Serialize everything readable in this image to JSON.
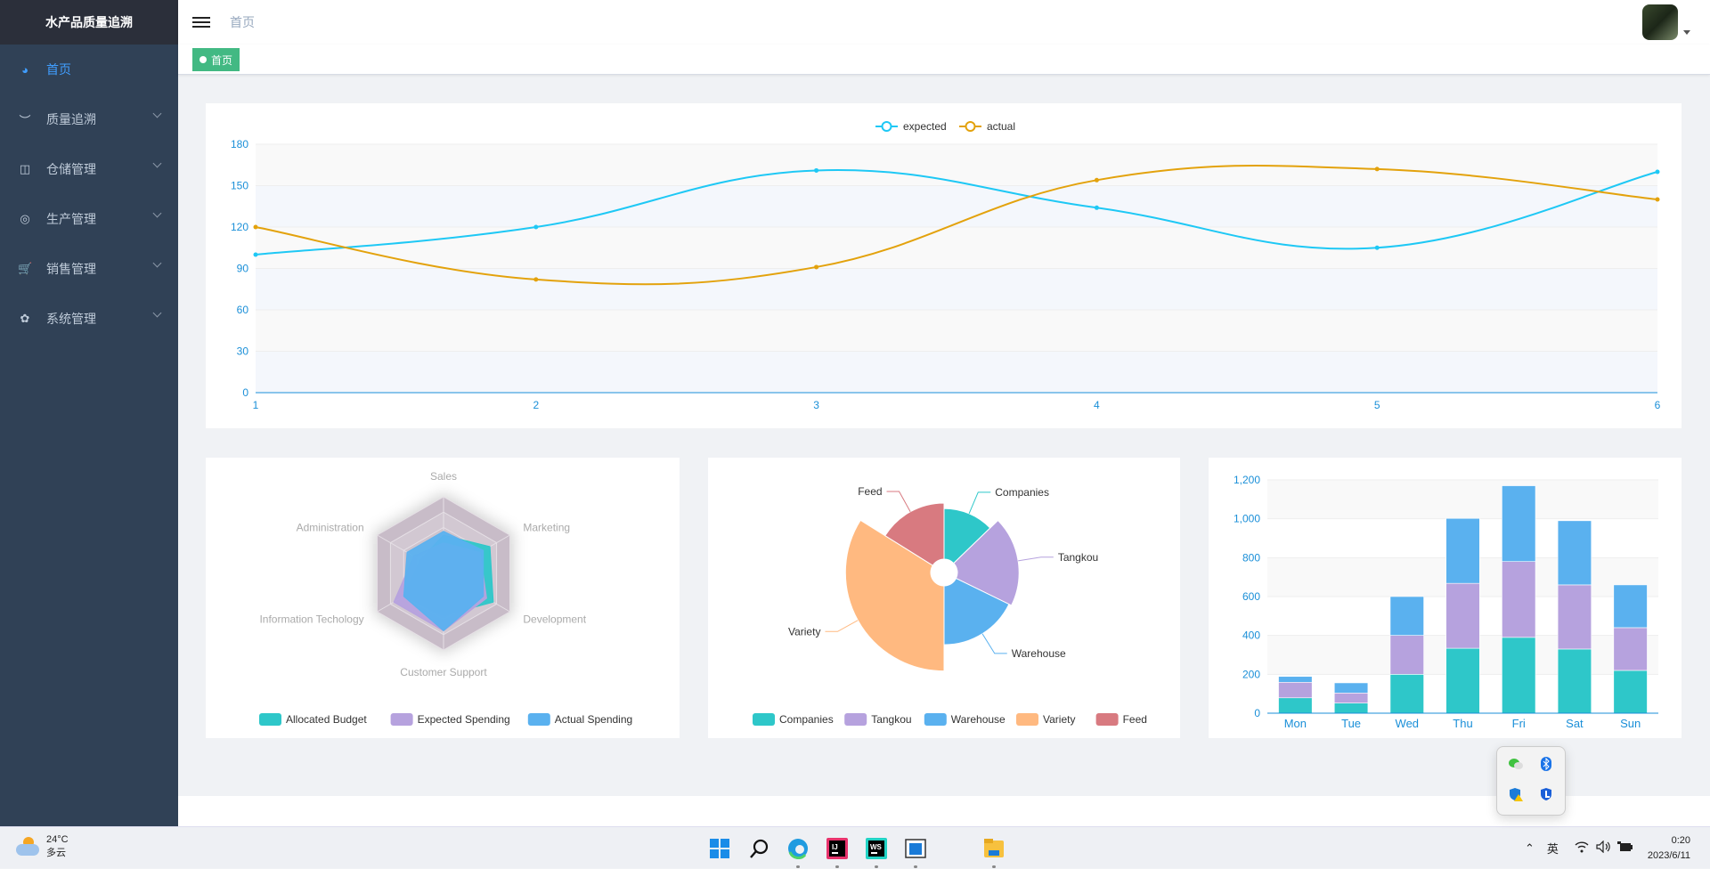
{
  "sidebar": {
    "title": "水产品质量追溯",
    "items": [
      {
        "label": "首页",
        "icon": "dashboard-icon",
        "active": true
      },
      {
        "label": "质量追溯",
        "icon": "eye-closed-icon",
        "expandable": true
      },
      {
        "label": "仓储管理",
        "icon": "table-icon",
        "expandable": true
      },
      {
        "label": "生产管理",
        "icon": "lifebuoy-icon",
        "expandable": true
      },
      {
        "label": "销售管理",
        "icon": "cart-icon",
        "expandable": true
      },
      {
        "label": "系统管理",
        "icon": "gear-icon",
        "expandable": true
      }
    ]
  },
  "header": {
    "breadcrumb": "首页"
  },
  "tags": [
    {
      "label": "首页",
      "active": true
    }
  ],
  "colors": {
    "expected": "#1ec8f5",
    "actual": "#e3a20c",
    "teal": "#2ec7c9",
    "purple": "#b6a2de",
    "blue": "#5ab1ef",
    "orange": "#ffb980",
    "red": "#d87a80",
    "tag": "#42b983",
    "sidebar": "#304156"
  },
  "chart_data": [
    {
      "type": "line",
      "smooth": true,
      "x": [
        "1",
        "2",
        "3",
        "4",
        "5",
        "6"
      ],
      "ylim": [
        0,
        180
      ],
      "yticks": [
        "0",
        "30",
        "60",
        "90",
        "120",
        "150",
        "180"
      ],
      "legend": "top",
      "series": [
        {
          "name": "expected",
          "values": [
            100,
            120,
            161,
            134,
            105,
            160
          ]
        },
        {
          "name": "actual",
          "values": [
            120,
            82,
            91,
            154,
            162,
            140
          ]
        }
      ]
    },
    {
      "type": "radar",
      "indicators": [
        {
          "name": "Sales",
          "max": 10000
        },
        {
          "name": "Administration",
          "max": 20000
        },
        {
          "name": "Information Techology",
          "max": 20000
        },
        {
          "name": "Customer Support",
          "max": 20000
        },
        {
          "name": "Development",
          "max": 20000
        },
        {
          "name": "Marketing",
          "max": 20000
        }
      ],
      "legend": "bottom",
      "series": [
        {
          "name": "Allocated Budget",
          "values": [
            5000,
            7000,
            12000,
            11000,
            15000,
            14000
          ]
        },
        {
          "name": "Expected Spending",
          "values": [
            4000,
            9000,
            15000,
            15000,
            13000,
            11000
          ]
        },
        {
          "name": "Actual Spending",
          "values": [
            5500,
            11000,
            12000,
            15000,
            12000,
            12000
          ]
        }
      ]
    },
    {
      "type": "pie",
      "rose": true,
      "legend": "bottom",
      "slices": [
        {
          "name": "Companies",
          "value": 46
        },
        {
          "name": "Tangkou",
          "value": 70
        },
        {
          "name": "Warehouse",
          "value": 64
        },
        {
          "name": "Variety",
          "value": 122
        },
        {
          "name": "Feed",
          "value": 58
        }
      ]
    },
    {
      "type": "bar",
      "stacked": true,
      "categories": [
        "Mon",
        "Tue",
        "Wed",
        "Thu",
        "Fri",
        "Sat",
        "Sun"
      ],
      "ylim": [
        0,
        1200
      ],
      "yticks": [
        "0",
        "200",
        "400",
        "600",
        "800",
        "1,000",
        "1,200"
      ],
      "series": [
        {
          "values": [
            79,
            52,
            200,
            334,
            390,
            330,
            220
          ]
        },
        {
          "values": [
            80,
            52,
            200,
            334,
            390,
            330,
            220
          ]
        },
        {
          "values": [
            30,
            52,
            200,
            334,
            390,
            330,
            220
          ]
        }
      ]
    }
  ],
  "taskbar": {
    "temp": "24°C",
    "weather": "多云",
    "ime": "英",
    "time": "0:20",
    "date": "2023/6/11"
  }
}
